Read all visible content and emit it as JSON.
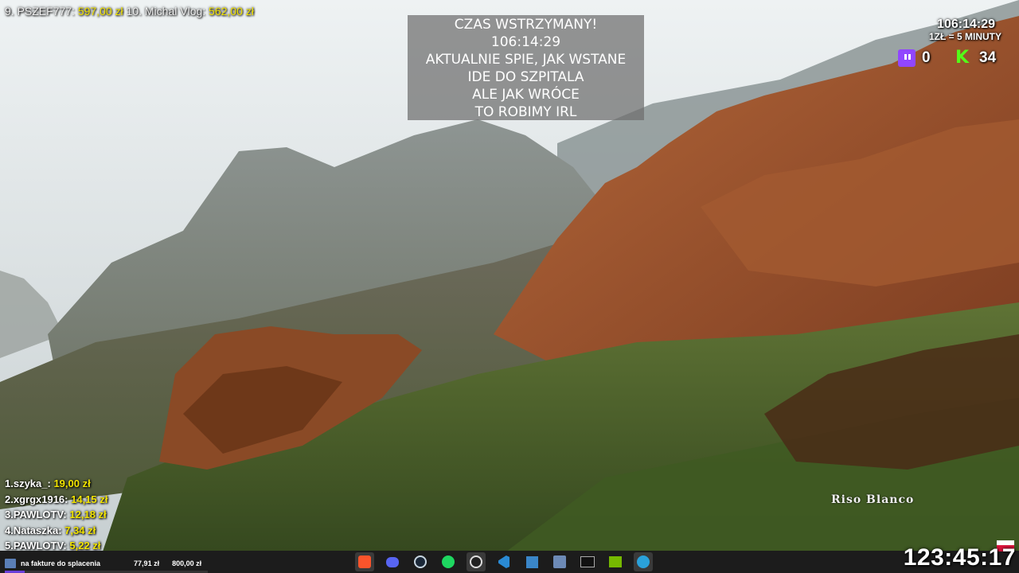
{
  "ticker": {
    "item9_name": "9. PSZEF777",
    "item9_amount": "597,00 zł",
    "item10_name": "10. Michal Vlog",
    "item10_amount": "562,00 zł"
  },
  "status": {
    "lines": [
      "CZAS WSTRZYMANY!",
      "106:14:29",
      "AKTUALNIE SPIE, JAK WSTANE",
      "IDE DO SZPITALA",
      "ALE JAK WRÓCE",
      "TO ROBIMY IRL"
    ]
  },
  "top_right": {
    "timer": "106:14:29",
    "rate": "1ZŁ = 5 MINUTY",
    "twitch_count": "0",
    "kick_count": "34"
  },
  "leaderboard": [
    {
      "name": "1.szyka_: ",
      "amount": "19,00 zł"
    },
    {
      "name": "2.xgrgx1916: ",
      "amount": "14,15 zł"
    },
    {
      "name": "3.PAWLOTV: ",
      "amount": "12,18 zł"
    },
    {
      "name": "4.Nataszka: ",
      "amount": "7,34 zł"
    },
    {
      "name": "5.PAWLOTV: ",
      "amount": "5,22 zł"
    }
  ],
  "watermark": "Riso Blanco",
  "goal": {
    "label": "na fakture do splacenia",
    "current": "77,91 zł",
    "target": "800,00 zł",
    "progress_fraction": 0.097
  },
  "taskbar_icons": [
    "brave-icon",
    "discord-icon",
    "steam-icon",
    "spotify-icon",
    "obs-icon",
    "vscode-icon",
    "files-icon",
    "network-icon",
    "terminal-icon",
    "nvidia-icon",
    "telegram-icon"
  ],
  "big_clock": "123:45:17",
  "colors": {
    "amount_yellow": "#f2e400",
    "twitch": "#9146ff",
    "kick": "#53fc18"
  }
}
